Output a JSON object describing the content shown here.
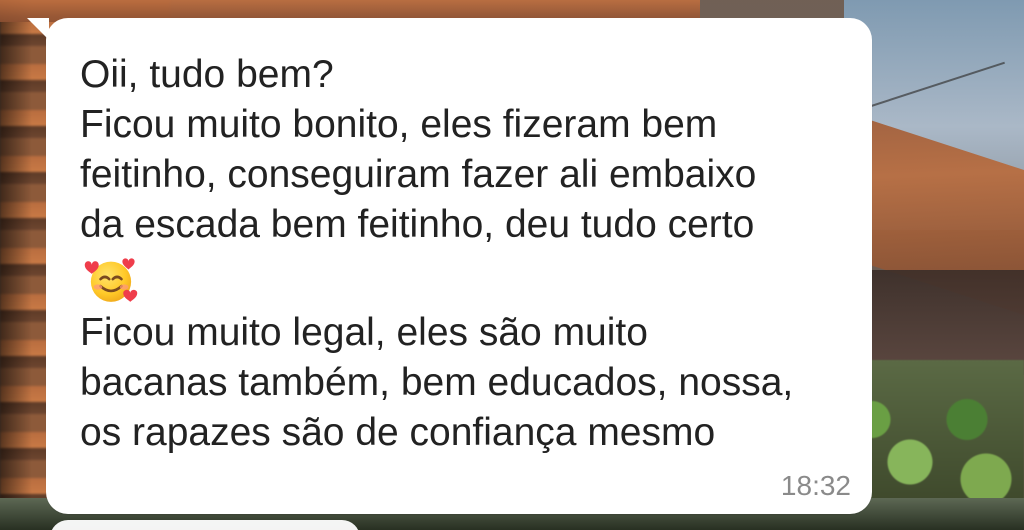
{
  "message": {
    "lines": [
      "Oii, tudo bem?",
      "Ficou muito bonito, eles fizeram bem",
      "feitinho, conseguiram fazer ali embaixo",
      "da escada bem feitinho, deu tudo certo",
      "Ficou muito legal, eles são muito",
      "bacanas também, bem educados, nossa,",
      "os rapazes são de confiança mesmo"
    ],
    "emoji": "smiling-face-with-hearts-icon",
    "time": "18:32"
  }
}
